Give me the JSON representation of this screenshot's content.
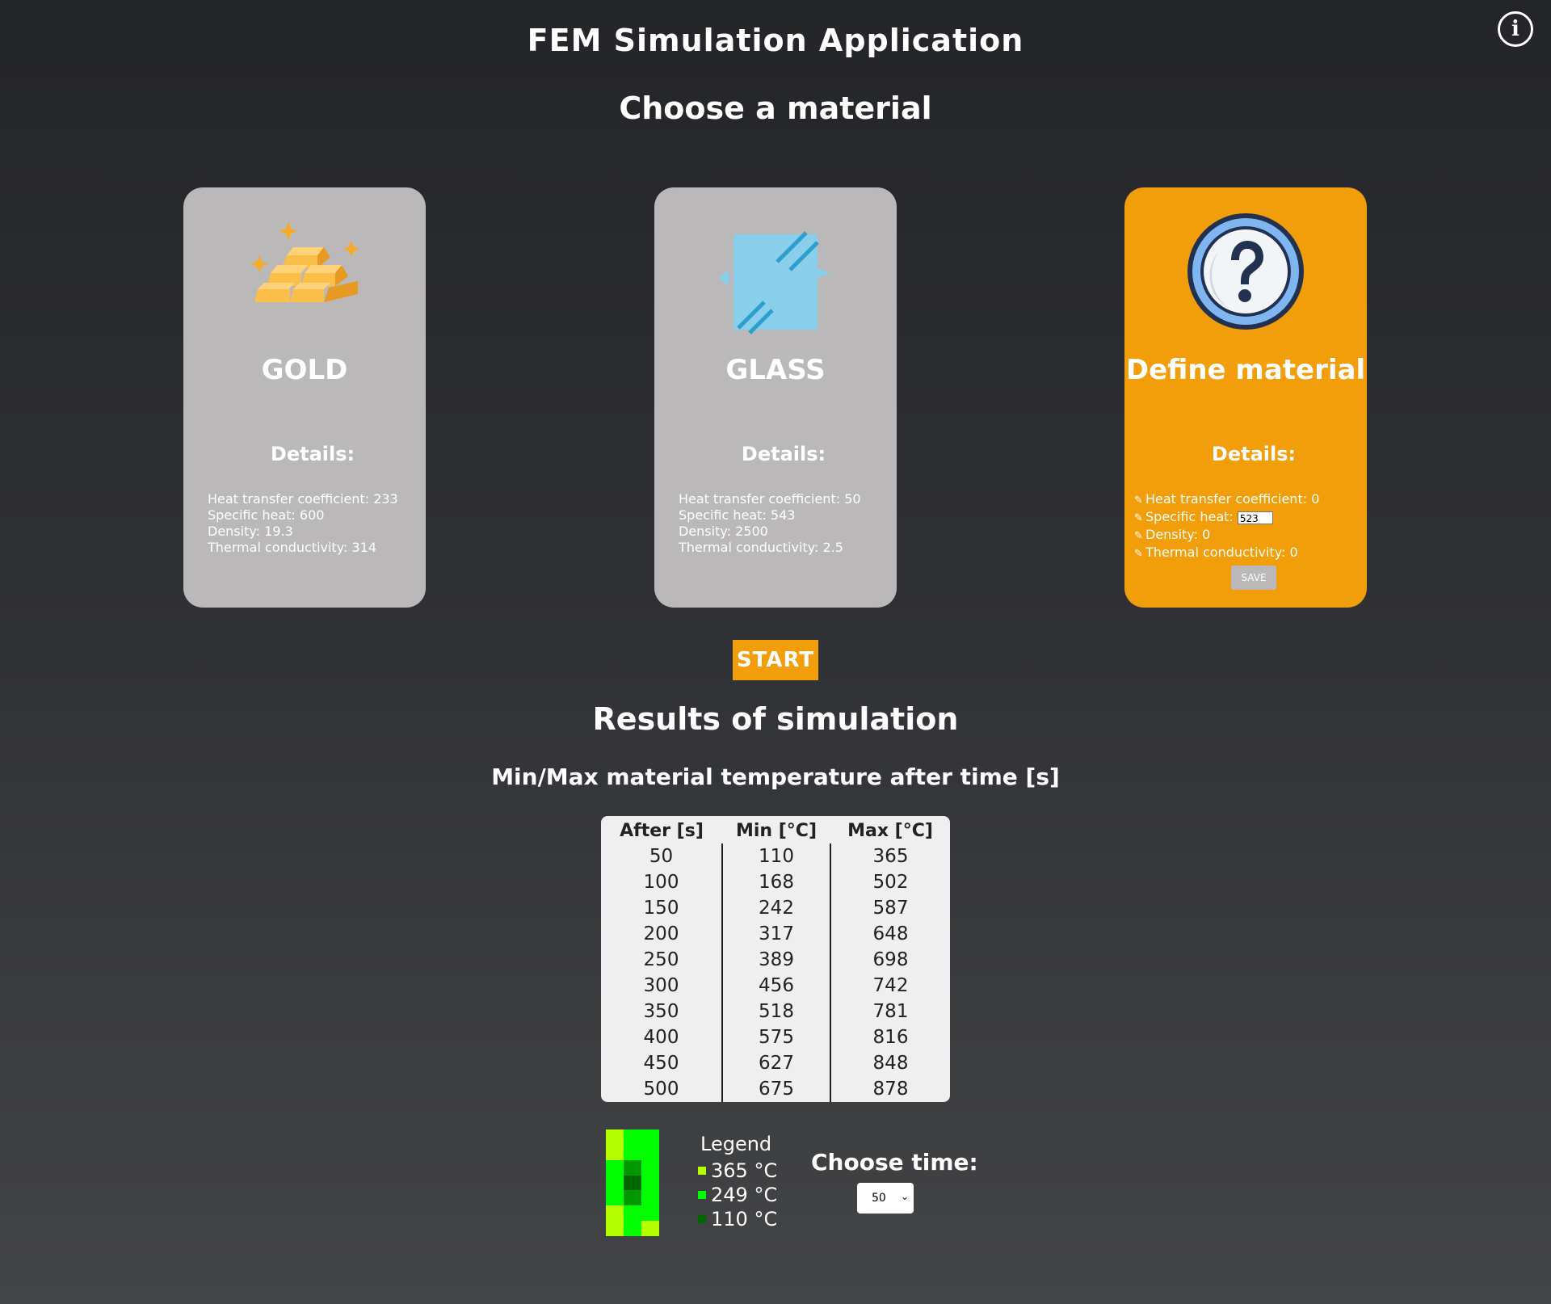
{
  "header": {
    "title": "FEM Simulation Application",
    "info_icon": "info-icon",
    "info_glyph": "i"
  },
  "materials_section": {
    "title": "Choose a material"
  },
  "materials": [
    {
      "name": "GOLD",
      "icon": "gold-bars-icon",
      "details_title": "Details:",
      "props": [
        "Heat transfer coefficient: 233",
        "Specific heat: 600",
        "Density: 19.3",
        "Thermal conductivity: 314"
      ]
    },
    {
      "name": "GLASS",
      "icon": "glass-pane-icon",
      "details_title": "Details:",
      "props": [
        "Heat transfer coefficient: 50",
        "Specific heat: 543",
        "Density: 2500",
        "Thermal conductivity: 2.5"
      ]
    },
    {
      "name": "Define material",
      "icon": "question-mark-icon",
      "details_title": "Details:",
      "props": [
        "Heat transfer coefficient: 0",
        "Specific heat: ",
        "Density: 0",
        "Thermal conductivity: 0"
      ],
      "specific_heat_input_value": "523",
      "save_label": "SAVE",
      "edit_icon": "pencil-icon",
      "accent_color": "#f29d0a"
    }
  ],
  "start_label": "START",
  "results": {
    "title": "Results of simulation",
    "subtitle": "Min/Max material temperature after time [s]",
    "columns": [
      "After [s]",
      "Min [°C]",
      "Max [°C]"
    ],
    "rows": [
      [
        "50",
        "110",
        "365"
      ],
      [
        "100",
        "168",
        "502"
      ],
      [
        "150",
        "242",
        "587"
      ],
      [
        "200",
        "317",
        "648"
      ],
      [
        "250",
        "389",
        "698"
      ],
      [
        "300",
        "456",
        "742"
      ],
      [
        "350",
        "518",
        "781"
      ],
      [
        "400",
        "575",
        "816"
      ],
      [
        "450",
        "627",
        "848"
      ],
      [
        "500",
        "675",
        "878"
      ]
    ]
  },
  "legend": {
    "title": "Legend",
    "entries": [
      {
        "label": "365 °C",
        "color": "#b6ff00"
      },
      {
        "label": "249 °C",
        "color": "#00ff00"
      },
      {
        "label": "110 °C",
        "color": "#006600"
      }
    ]
  },
  "heatmap": {
    "cells": [
      [
        "#b6ff00",
        "#00ff00",
        "#00ff00"
      ],
      [
        "#b6ff00",
        "#00ff00",
        "#00ff00"
      ],
      [
        "#00ff00",
        "#009900",
        "#00ff00"
      ],
      [
        "#00ff00",
        "#006600",
        "#00ff00"
      ],
      [
        "#00ff00",
        "#009900",
        "#00ff00"
      ],
      [
        "#b6ff00",
        "#00ff00",
        "#00ff00"
      ],
      [
        "#b6ff00",
        "#00ff00",
        "#b6ff00"
      ]
    ]
  },
  "time_picker": {
    "label": "Choose time:",
    "selected": "50"
  }
}
